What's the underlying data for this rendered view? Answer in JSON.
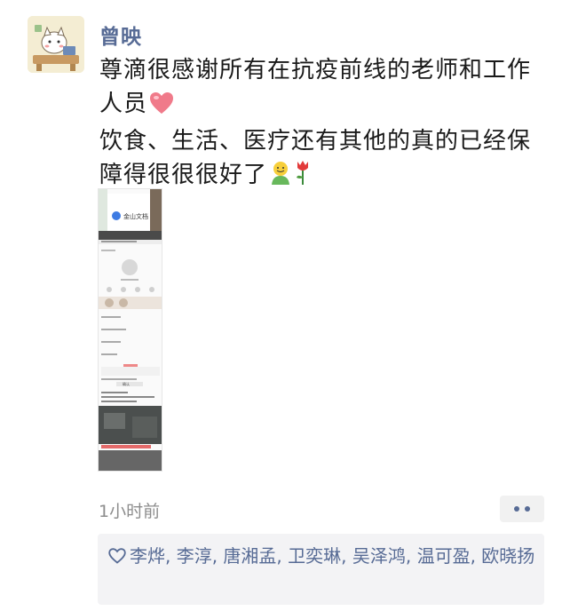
{
  "post": {
    "author": "曾映",
    "text_lines": [
      "尊滴很感谢所有在抗疫前线的老师和工作",
      "人员",
      "饮食、生活、医疗还有其他的真的已经保",
      "障得很很很好了"
    ],
    "icons": [
      "heart-emoji",
      "smiley-person-emoji",
      "rose-emoji"
    ],
    "timestamp": "1小时前",
    "likes": "李烨, 李淳, 唐湘孟, 卫奕琳, 吴泽鸿, 温可盈, 欧晓扬"
  },
  "media_preview": {
    "header_label": "金山文档",
    "button_label": "确认"
  },
  "colors": {
    "name": "#576b95",
    "background": "#ffffff",
    "likes_background": "#f3f3f5",
    "timestamp": "#8d8d8d"
  }
}
